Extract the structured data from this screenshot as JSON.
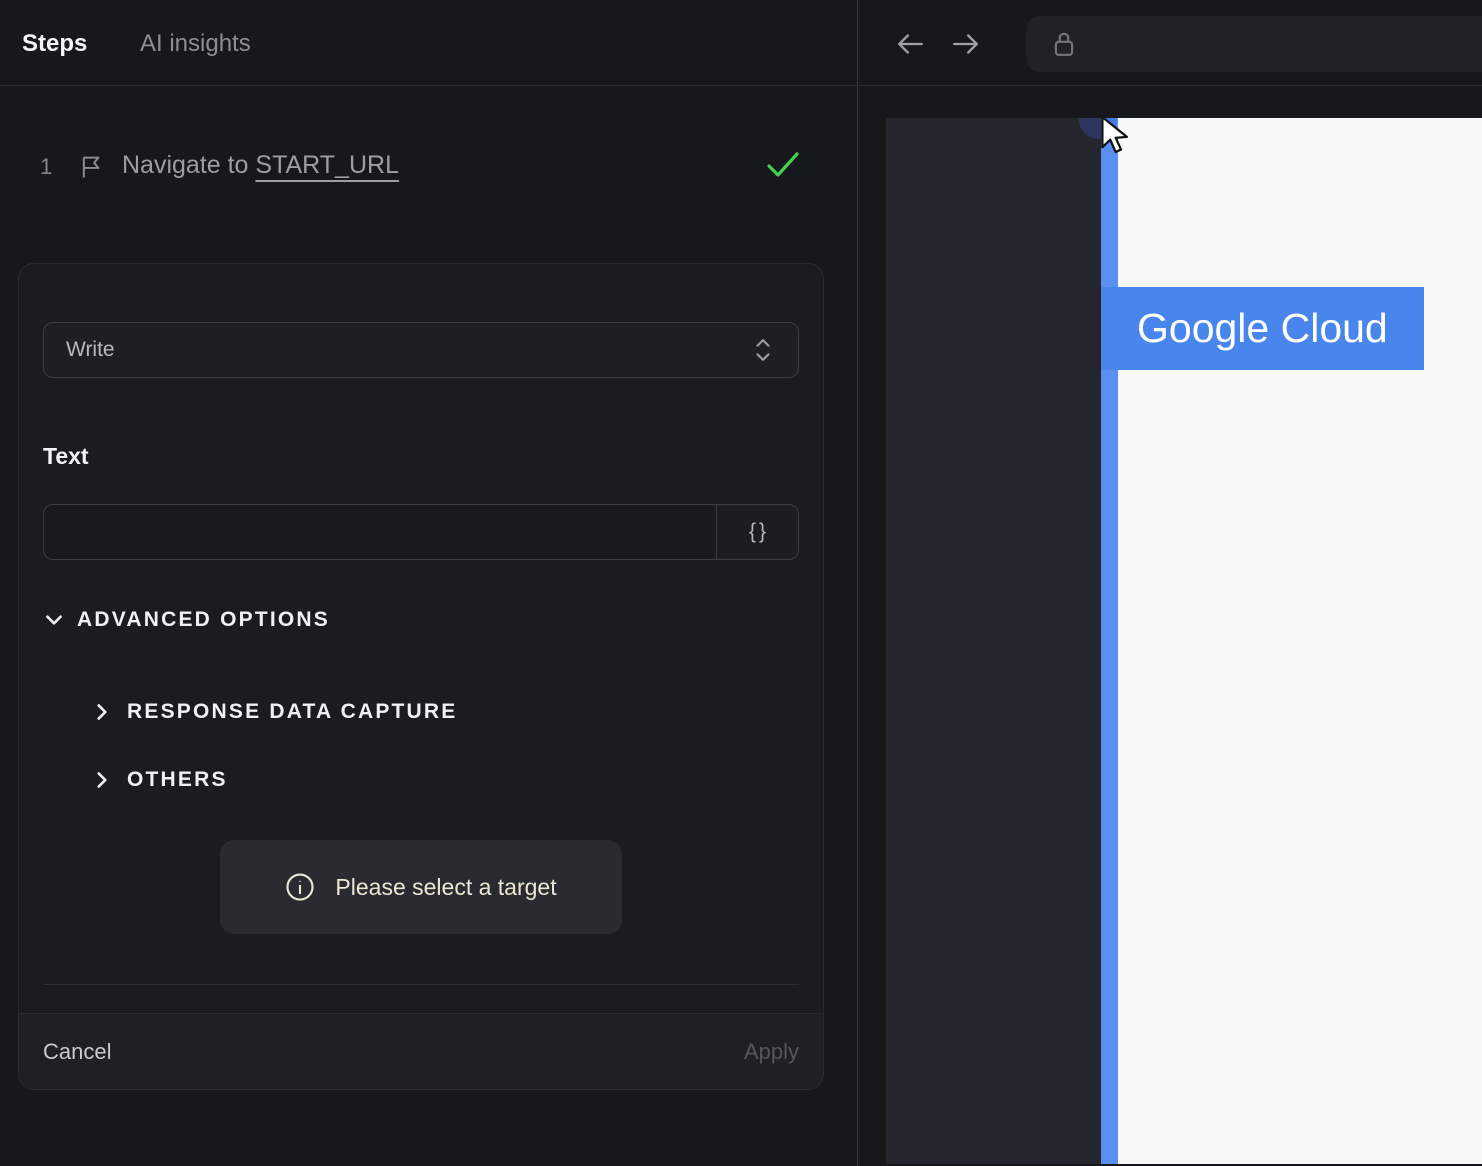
{
  "left_panel": {
    "tabs": [
      {
        "label": "Steps",
        "active": true
      },
      {
        "label": "AI insights",
        "active": false
      }
    ],
    "step": {
      "number": "1",
      "action": "Navigate to ",
      "target": "START_URL",
      "status": "success"
    },
    "editor": {
      "action_value": "Write",
      "text_label": "Text",
      "text_value": "",
      "variable_button_label": "{}",
      "advanced_options_label": "ADVANCED OPTIONS",
      "response_data_capture_label": "RESPONSE DATA CAPTURE",
      "others_label": "OTHERS",
      "target_notice": "Please select a target",
      "cancel_label": "Cancel",
      "apply_label": "Apply"
    }
  },
  "right_panel": {
    "address_value": "",
    "page": {
      "brand": "Google Cloud"
    }
  },
  "icons": {
    "flag-icon": "pennant flag outline",
    "check-icon": "green checkmark",
    "unfold-icon": "up-down chevrons",
    "chevron-down-icon": "v",
    "chevron-right-icon": ">",
    "curly-braces-icon": "{}",
    "info-icon": "circled i",
    "back-arrow-icon": "left arrow",
    "forward-arrow-icon": "right arrow",
    "lock-icon": "padlock outline",
    "cursor-pointer-icon": "mouse arrow pointer"
  },
  "colors": {
    "accent_blue": "#4886ee",
    "success_green": "#42d24c",
    "notice_text": "#ece6d5",
    "highlight_indigo": "#2e355f",
    "panel_bg": "#17181c",
    "preview_dark": "#25262d",
    "page_white": "#f8f8f9"
  }
}
